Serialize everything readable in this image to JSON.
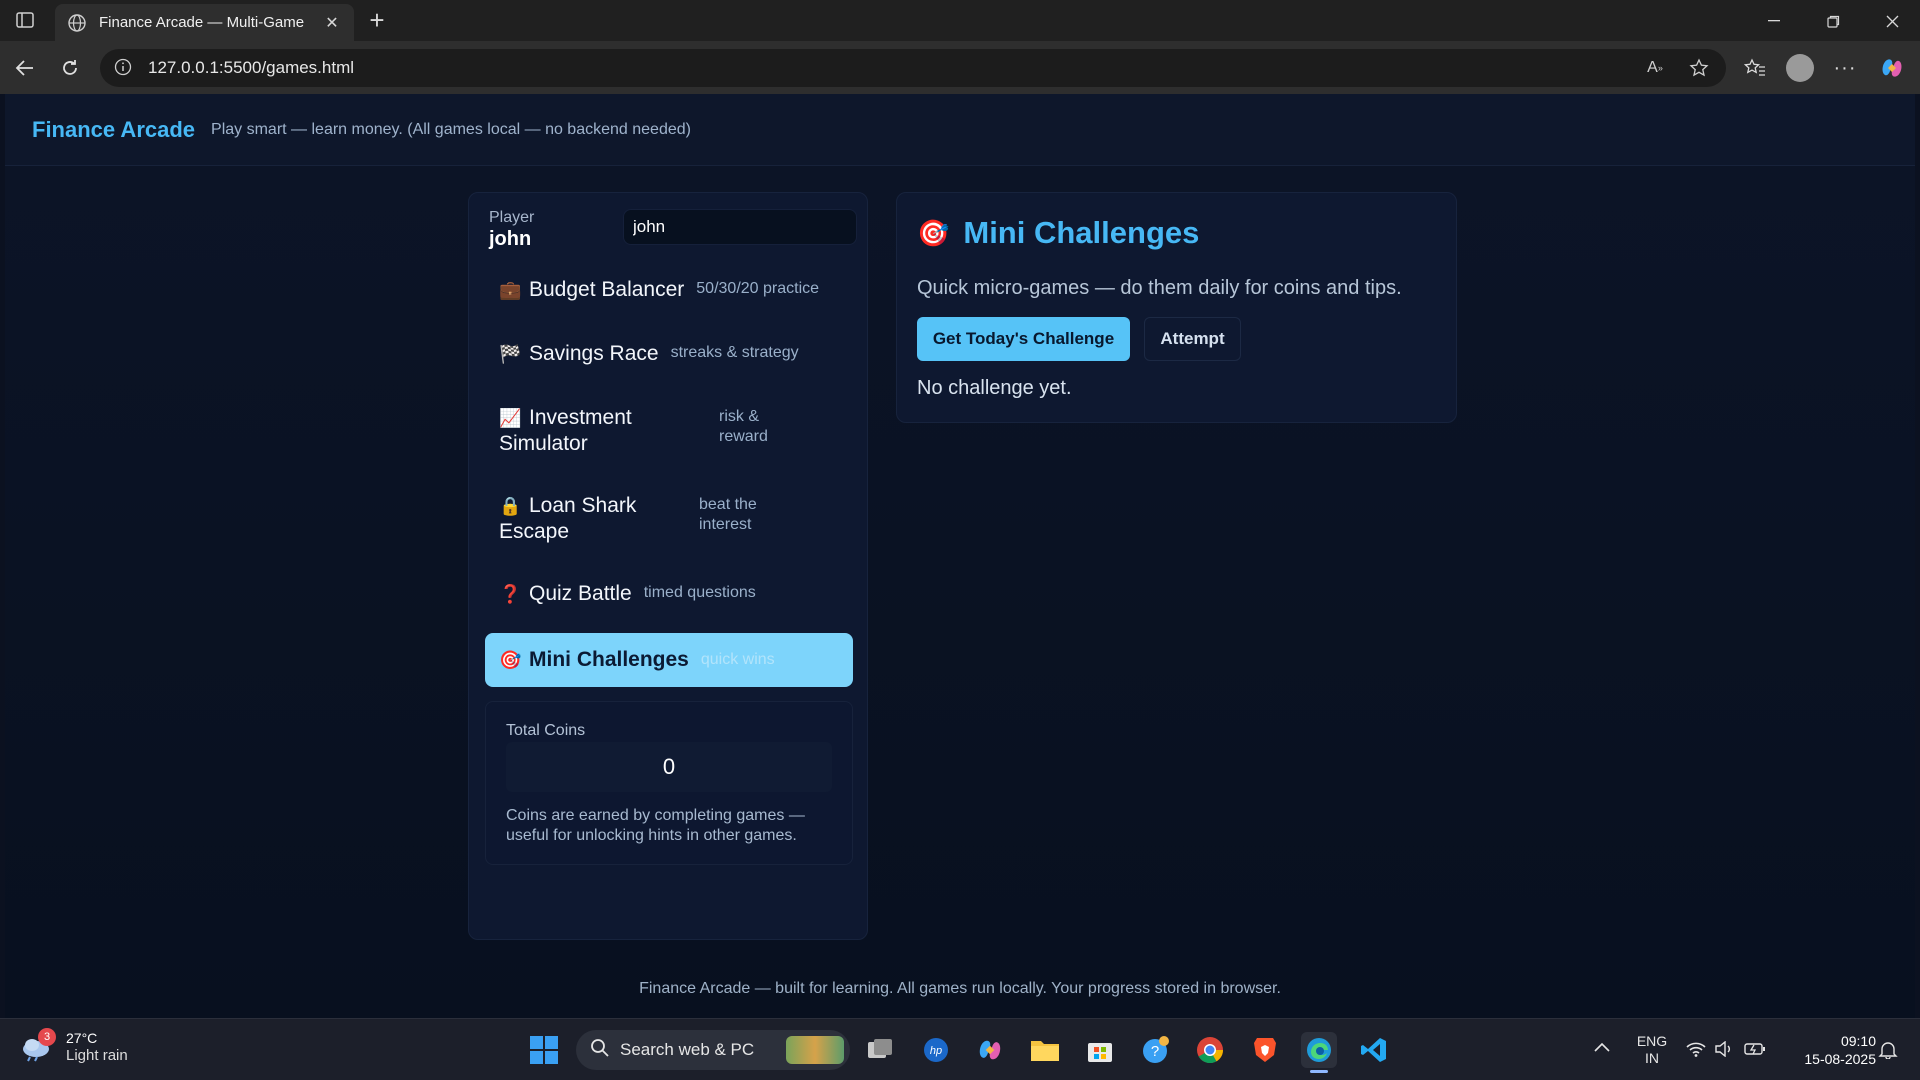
{
  "browser": {
    "tab_title": "Finance Arcade — Multi-Game",
    "url": "127.0.0.1:5500/games.html"
  },
  "app": {
    "brand": "Finance Arcade",
    "tagline": "Play smart — learn money. (All games local — no backend needed)"
  },
  "player": {
    "label": "Player",
    "name": "john",
    "input_value": "john"
  },
  "games": [
    {
      "icon": "💼",
      "name": "Budget Balancer",
      "desc": "50/30/20 practice"
    },
    {
      "icon": "🏁",
      "name": "Savings Race",
      "desc": "streaks & strategy"
    },
    {
      "icon": "📈",
      "name": "Investment Simulator",
      "desc": "risk & reward"
    },
    {
      "icon": "🔒",
      "name": "Loan Shark Escape",
      "desc": "beat the interest"
    },
    {
      "icon": "❓",
      "name": "Quiz Battle",
      "desc": "timed questions"
    },
    {
      "icon": "🎯",
      "name": "Mini Challenges",
      "desc": "quick wins"
    }
  ],
  "coins": {
    "label": "Total Coins",
    "value": "0",
    "note": "Coins are earned by completing games — useful for unlocking hints in other games."
  },
  "challenge": {
    "icon": "🎯",
    "title": "Mini Challenges",
    "subtitle": "Quick micro-games — do them daily for coins and tips.",
    "primary_button": "Get Today's Challenge",
    "secondary_button": "Attempt",
    "status": "No challenge yet."
  },
  "footer": "Finance Arcade — built for learning. All games run locally. Your progress stored in browser.",
  "taskbar": {
    "weather_badge": "3",
    "weather_temp": "27°C",
    "weather_desc": "Light rain",
    "search_placeholder": "Search web & PC",
    "lang_top": "ENG",
    "lang_bottom": "IN",
    "time": "09:10",
    "date": "15-08-2025"
  },
  "colors": {
    "accent": "#47b8f5",
    "active_item": "#7dd4fb",
    "background": "#0b1120"
  }
}
